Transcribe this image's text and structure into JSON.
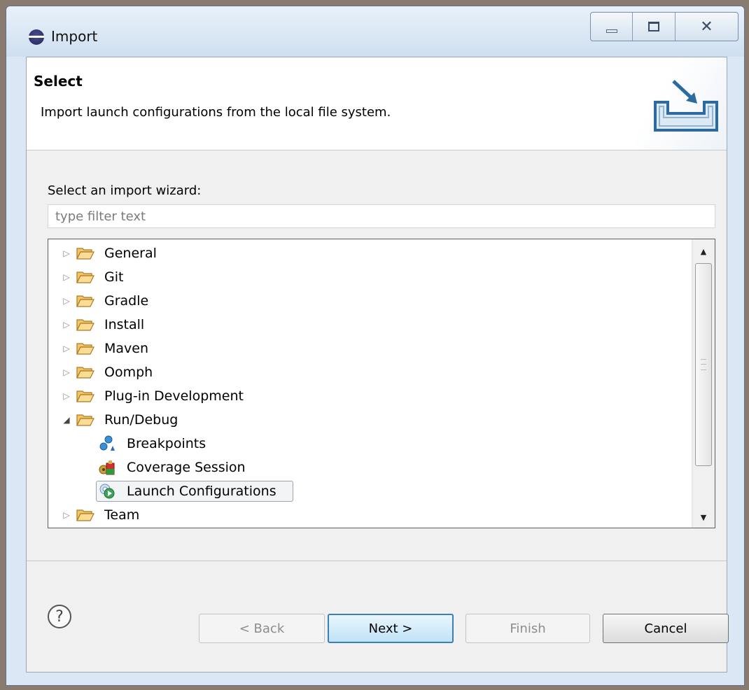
{
  "window": {
    "title": "Import",
    "controls": {
      "minimize": "minimize",
      "maximize": "maximize",
      "close": "close"
    }
  },
  "header": {
    "title": "Select",
    "description": "Import launch configurations from the local file system.",
    "graphic_icon": "import-tray-icon"
  },
  "wizard": {
    "select_label": "Select an import wizard:",
    "filter_placeholder": "type filter text",
    "filter_value": ""
  },
  "tree": {
    "items": [
      {
        "label": "General",
        "type": "folder",
        "expanded": false
      },
      {
        "label": "Git",
        "type": "folder",
        "expanded": false
      },
      {
        "label": "Gradle",
        "type": "folder",
        "expanded": false
      },
      {
        "label": "Install",
        "type": "folder",
        "expanded": false
      },
      {
        "label": "Maven",
        "type": "folder",
        "expanded": false
      },
      {
        "label": "Oomph",
        "type": "folder",
        "expanded": false
      },
      {
        "label": "Plug-in Development",
        "type": "folder",
        "expanded": false
      },
      {
        "label": "Run/Debug",
        "type": "folder",
        "expanded": true
      },
      {
        "label": "Breakpoints",
        "type": "leaf",
        "icon": "breakpoints-icon"
      },
      {
        "label": "Coverage Session",
        "type": "leaf",
        "icon": "coverage-session-icon"
      },
      {
        "label": "Launch Configurations",
        "type": "leaf",
        "icon": "launch-configurations-icon",
        "selected": true
      },
      {
        "label": "Team",
        "type": "folder",
        "expanded": false
      }
    ]
  },
  "footer": {
    "back_label": "< Back",
    "next_label": "Next >",
    "finish_label": "Finish",
    "cancel_label": "Cancel",
    "help_symbol": "?"
  },
  "colors": {
    "folder": "#f2c46b",
    "folder_outline": "#b07a1c",
    "default_button_border": "#3c7fb1"
  }
}
